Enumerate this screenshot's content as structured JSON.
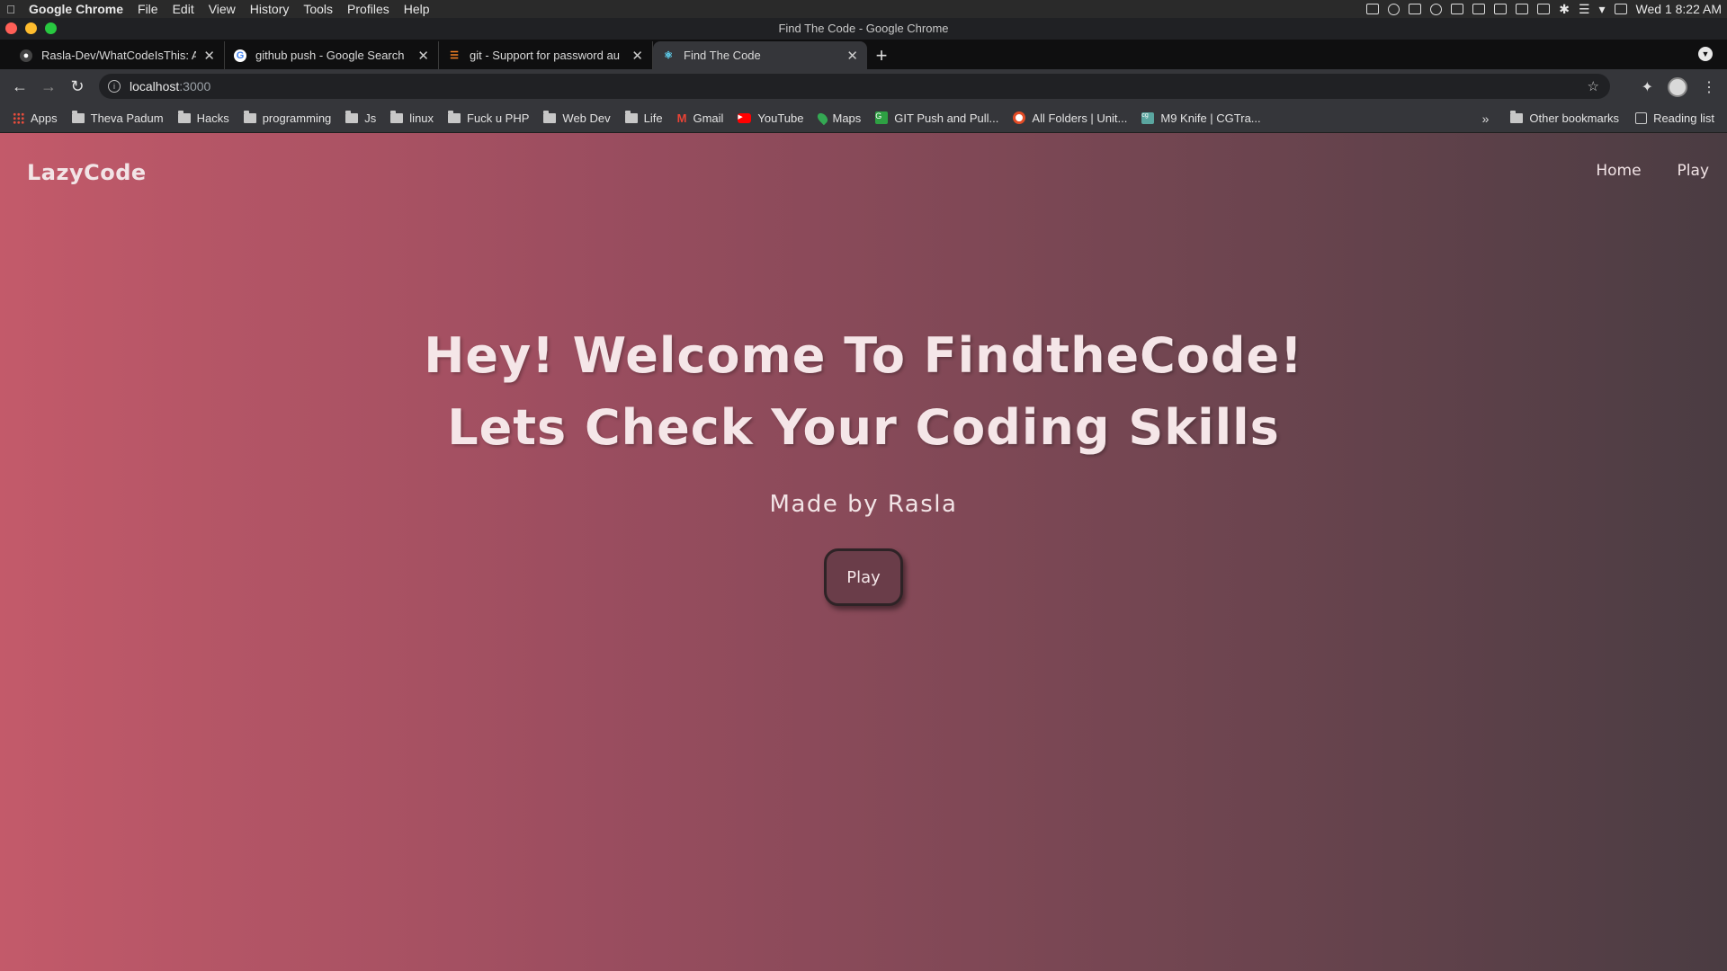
{
  "menubar": {
    "app_name": "Google Chrome",
    "items": [
      "File",
      "Edit",
      "View",
      "History",
      "Tools",
      "Profiles",
      "Help"
    ],
    "clock": "Wed 1  8:22 AM"
  },
  "window": {
    "title": "Find The Code - Google Chrome"
  },
  "tabs": [
    {
      "label": "Rasla-Dev/WhatCodeIsThis: A",
      "icon": "github-icon"
    },
    {
      "label": "github push - Google Search",
      "icon": "google-icon"
    },
    {
      "label": "git - Support for password au",
      "icon": "stackoverflow-icon"
    },
    {
      "label": "Find The Code",
      "icon": "react-icon",
      "active": true
    }
  ],
  "address_bar": {
    "host": "localhost",
    "port": ":3000"
  },
  "bookmarks": [
    {
      "label": "Apps",
      "icon": "apps-grid-icon"
    },
    {
      "label": "Theva Padum",
      "icon": "folder-icon"
    },
    {
      "label": "Hacks",
      "icon": "folder-icon"
    },
    {
      "label": "programming",
      "icon": "folder-icon"
    },
    {
      "label": "Js",
      "icon": "folder-icon"
    },
    {
      "label": "linux",
      "icon": "folder-icon"
    },
    {
      "label": "Fuck u PHP",
      "icon": "folder-icon"
    },
    {
      "label": "Web Dev",
      "icon": "folder-icon"
    },
    {
      "label": "Life",
      "icon": "folder-icon"
    },
    {
      "label": "Gmail",
      "icon": "gmail-icon"
    },
    {
      "label": "YouTube",
      "icon": "youtube-icon"
    },
    {
      "label": "Maps",
      "icon": "maps-icon"
    },
    {
      "label": "GIT Push and Pull...",
      "icon": "git-page-icon"
    },
    {
      "label": "All Folders | Unit...",
      "icon": "allfolders-icon"
    },
    {
      "label": "M9 Knife | CGTra...",
      "icon": "cgtrader-icon"
    }
  ],
  "bookmarks_right": {
    "other": "Other bookmarks",
    "reading": "Reading list"
  },
  "site": {
    "brand": "LazyCode",
    "nav": [
      "Home",
      "Play"
    ],
    "headline_1": "Hey! Welcome To FindtheCode!",
    "headline_2": "Lets Check Your Coding Skills",
    "byline": "Made by Rasla",
    "play_button": "Play"
  }
}
